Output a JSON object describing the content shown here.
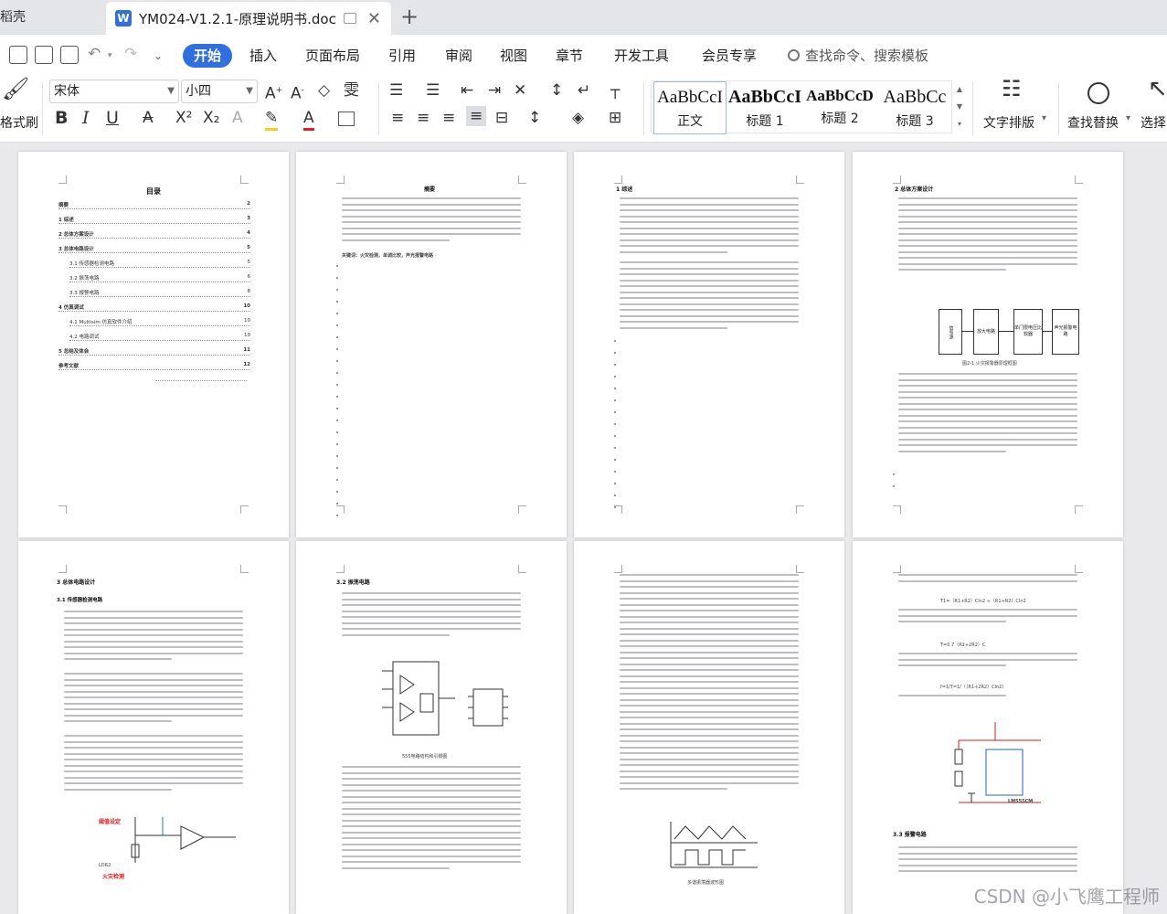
{
  "tabs": {
    "previous": "稻壳",
    "active_title": "YM024-V1.2.1-原理说明书.doc"
  },
  "menu": {
    "items": [
      "开始",
      "插入",
      "页面布局",
      "引用",
      "审阅",
      "视图",
      "章节",
      "开发工具",
      "会员专享"
    ],
    "search_placeholder": "查找命令、搜索模板"
  },
  "ribbon": {
    "format_painter": "格式刷",
    "font_name": "宋体",
    "font_size": "小四",
    "bold": "B",
    "italic": "I",
    "underline": "U",
    "styles": [
      {
        "preview": "AaBbCcI",
        "name": "正文"
      },
      {
        "preview": "AaBbCcI",
        "name": "标题 1"
      },
      {
        "preview": "AaBbCcD",
        "name": "标题 2"
      },
      {
        "preview": "AaBbCc",
        "name": "标题 3"
      }
    ],
    "text_layout": "文字排版",
    "find_replace": "查找替换",
    "select": "选择"
  },
  "pages": {
    "toc": {
      "title": "目录",
      "entries": [
        {
          "text": "摘要",
          "page": "2"
        },
        {
          "text": "1 综述",
          "page": "3"
        },
        {
          "text": "2 总体方案设计",
          "page": "4"
        },
        {
          "text": "3 总体电路设计",
          "page": "5"
        },
        {
          "text": "3.1 传感器检测电路",
          "page": "5"
        },
        {
          "text": "3.2 振荡电路",
          "page": "6"
        },
        {
          "text": "3.3 报警电路",
          "page": "8"
        },
        {
          "text": "4 仿真调试",
          "page": "10"
        },
        {
          "text": "4.1 Multisim 仿真软件介绍",
          "page": "10"
        },
        {
          "text": "4.2 电路调试",
          "page": "10"
        },
        {
          "text": "5 总结及体会",
          "page": "11"
        },
        {
          "text": "参考文献",
          "page": "12"
        }
      ]
    },
    "abstract": {
      "title": "摘要",
      "keywords": "关键词：火灾检测，单调比较，声光报警电路"
    },
    "overview": {
      "heading": "1 综述"
    },
    "scheme": {
      "heading": "2 总体方案设计",
      "blocks": [
        "信号源",
        "放大电路",
        "单门限电压比较器",
        "声光报警电路"
      ],
      "caption": "图2-1 火灾报警器原理框图"
    },
    "circuit": {
      "heading": "3 总体电路设计",
      "sub": "3.1 传感器检测电路",
      "red_labels": [
        "阈值设定",
        "火灾检测"
      ]
    },
    "oscillator": {
      "heading": "3.2 振荡电路",
      "caption": "555电路结构和引脚图"
    },
    "waveform": {
      "caption": "多谐振荡器波形图"
    },
    "alarm": {
      "heading": "3.3 报警电路",
      "formulas": [
        "T1=（R1+R2）Cln2 ≈（R1+R2）Cln2",
        "T=0.7（R1+2R2）C",
        "f=1/T=1/（（R1+2R2）Cln2）"
      ],
      "chip": "LM555CM"
    }
  },
  "watermark": "CSDN @小飞鹰工程师"
}
